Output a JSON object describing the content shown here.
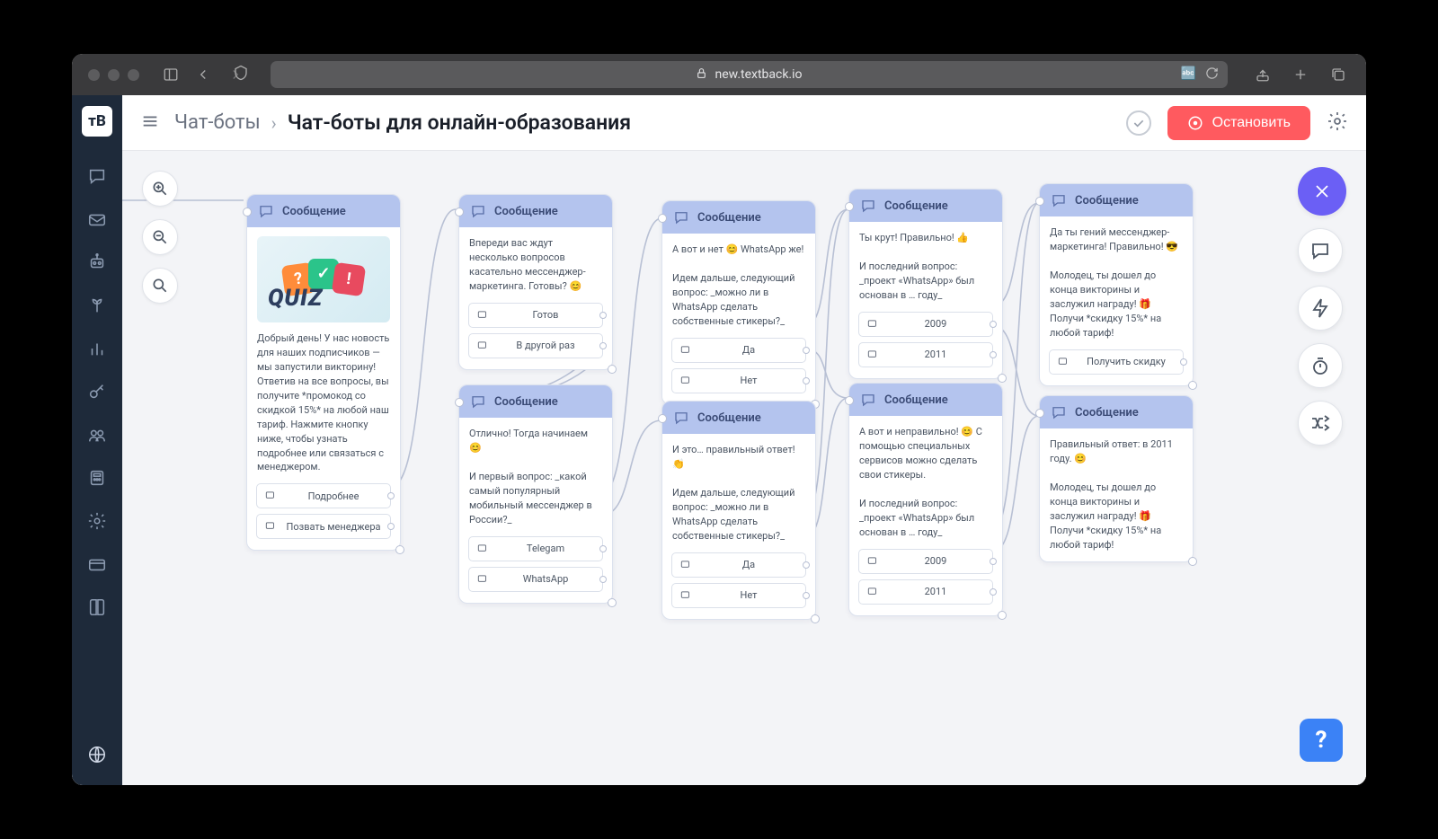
{
  "browser": {
    "url": "new.textback.io",
    "lock": true
  },
  "header": {
    "breadcrumb_root": "Чат-боты",
    "breadcrumb_current": "Чат-боты для онлайн-образования",
    "stop_label": "Остановить"
  },
  "nodes": {
    "n1": {
      "title": "Сообщение",
      "body": "Добрый день! У нас новость для наших подписчиков — мы запустили викторину! Ответив на все вопросы, вы получите *промокод со скидкой 15%* на любой наш тариф. Нажмите кнопку ниже, чтобы узнать подробнее или связаться с менеджером.",
      "has_image": true,
      "quiz_label": "QUIZ",
      "buttons": [
        "Подробнее",
        "Позвать менеджера"
      ]
    },
    "n2": {
      "title": "Сообщение",
      "body": "Впереди вас ждут несколько вопросов касательно мессенджер-маркетинга. Готовы? 😊",
      "buttons": [
        "Готов",
        "В другой раз"
      ]
    },
    "n3": {
      "title": "Сообщение",
      "body": "Отлично! Тогда начинаем 😊\n\nИ первый вопрос: _какой самый популярный мобильный мессенджер в России?_",
      "buttons": [
        "Telegam",
        "WhatsApp"
      ]
    },
    "n4": {
      "title": "Сообщение",
      "body": "А вот и нет 😊 WhatsApp же!\n\nИдем дальше, следующий вопрос: _можно ли в WhatsApp сделать собственные стикеры?_",
      "buttons": [
        "Да",
        "Нет"
      ]
    },
    "n5": {
      "title": "Сообщение",
      "body": "И это… правильный ответ! 👏\n\nИдем дальше, следующий вопрос: _можно ли в WhatsApp сделать собственные стикеры?_",
      "buttons": [
        "Да",
        "Нет"
      ]
    },
    "n6": {
      "title": "Сообщение",
      "body": "Ты крут! Правильно! 👍\n\nИ последний вопрос: _проект «WhatsApp» был основан в … году_",
      "buttons": [
        "2009",
        "2011"
      ]
    },
    "n7": {
      "title": "Сообщение",
      "body": "А вот и неправильно! 😊 С помощью специальных сервисов можно сделать свои стикеры.\n\nИ последний вопрос: _проект «WhatsApp» был основан в … году_",
      "buttons": [
        "2009",
        "2011"
      ]
    },
    "n8": {
      "title": "Сообщение",
      "body": "Да ты гений мессенджер-маркетинга! Правильно! 😎\n\nМолодец, ты дошел до конца викторины и заслужил награду! 🎁 Получи *скидку 15%* на любой тариф!",
      "buttons": [
        "Получить скидку"
      ]
    },
    "n9": {
      "title": "Сообщение",
      "body": "Правильный ответ: в 2011 году. 😊\n\nМолодец, ты дошел до конца викторины и заслужил награду! 🎁 Получи *скидку 15%* на любой тариф!",
      "buttons": []
    }
  },
  "help_label": "?"
}
